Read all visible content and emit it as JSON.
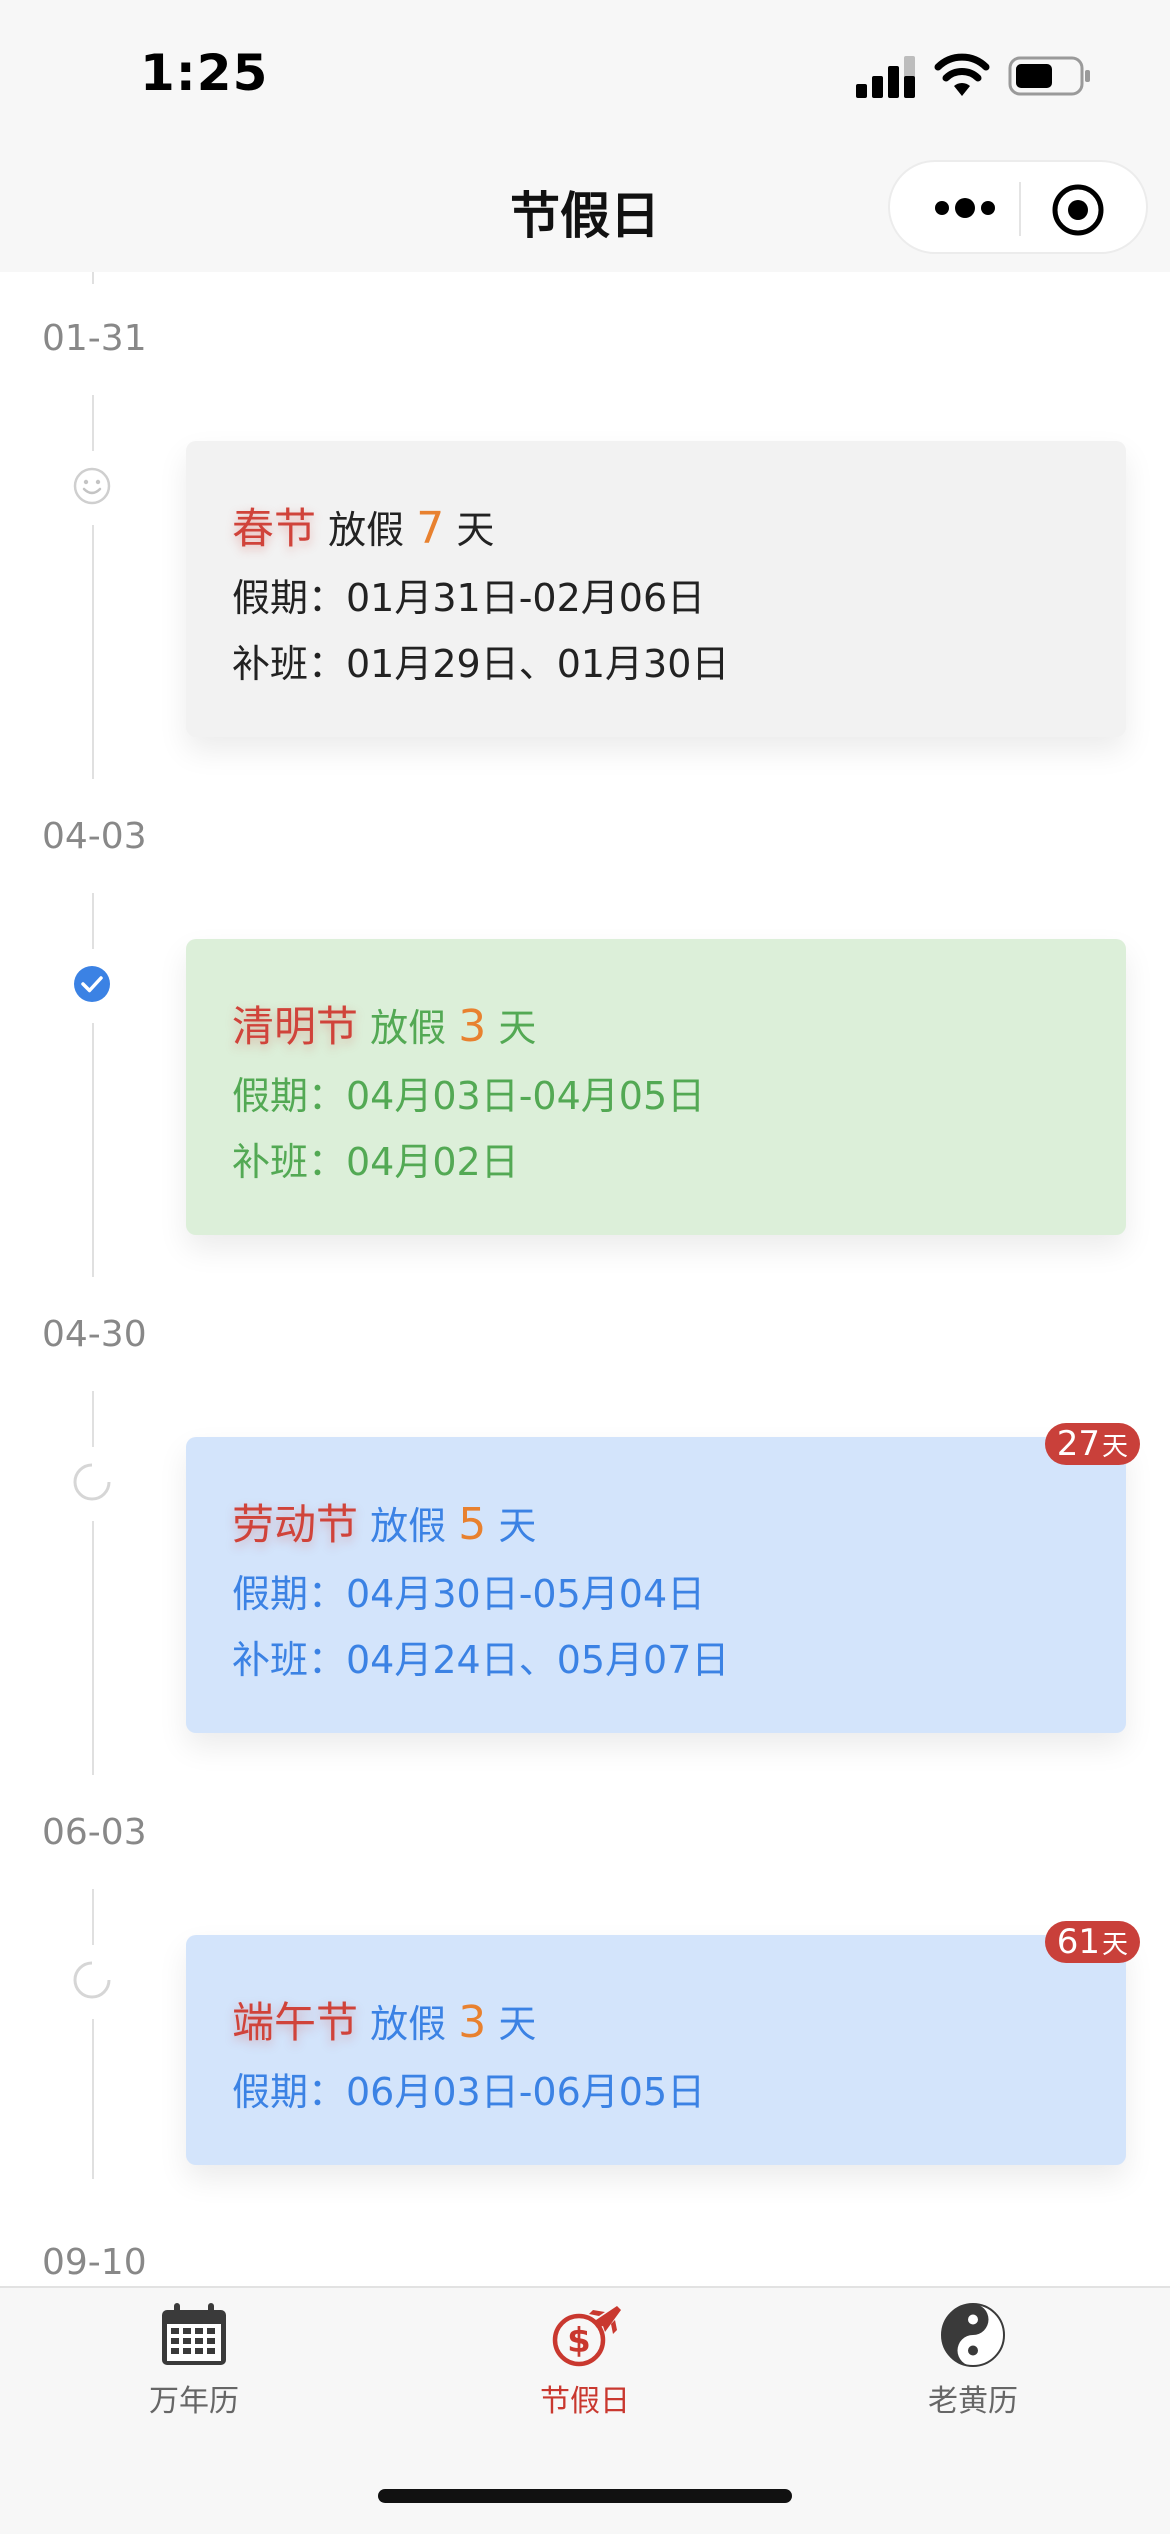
{
  "status_bar": {
    "time": "1:25"
  },
  "nav": {
    "title": "节假日"
  },
  "timeline": [
    {
      "date": "01-31",
      "name": "春节",
      "off_label": "放假",
      "days": "7",
      "unit": "天",
      "holiday_text": "假期：01月31日-02月06日",
      "makeup_text": "补班：01月29日、01月30日",
      "status": "past",
      "status_icon": "smile-icon",
      "bg": "#f2f2f2",
      "text_color": "#222222",
      "badge": null
    },
    {
      "date": "04-03",
      "name": "清明节",
      "off_label": "放假",
      "days": "3",
      "unit": "天",
      "holiday_text": "假期：04月03日-04月05日",
      "makeup_text": "补班：04月02日",
      "status": "current",
      "status_icon": "check-circle-icon",
      "bg": "#dcefd9",
      "text_color": "#53a954",
      "badge": null
    },
    {
      "date": "04-30",
      "name": "劳动节",
      "off_label": "放假",
      "days": "5",
      "unit": "天",
      "holiday_text": "假期：04月30日-05月04日",
      "makeup_text": "补班：04月24日、05月07日",
      "status": "upcoming",
      "status_icon": "loading-circle-icon",
      "bg": "#d3e4fb",
      "text_color": "#3b82e4",
      "badge": {
        "value": "27",
        "unit": "天"
      }
    },
    {
      "date": "06-03",
      "name": "端午节",
      "off_label": "放假",
      "days": "3",
      "unit": "天",
      "holiday_text": "假期：06月03日-06月05日",
      "makeup_text": "",
      "status": "upcoming",
      "status_icon": "loading-circle-icon",
      "bg": "#d3e4fb",
      "text_color": "#3b82e4",
      "badge": {
        "value": "61",
        "unit": "天"
      }
    },
    {
      "date": "09-10"
    }
  ],
  "tabbar": {
    "tabs": [
      {
        "label": "万年历",
        "icon": "calendar-icon",
        "active": false
      },
      {
        "label": "节假日",
        "icon": "holiday-money-icon",
        "active": true
      },
      {
        "label": "老黄历",
        "icon": "yin-yang-icon",
        "active": false
      }
    ],
    "active_color": "#c9382f",
    "inactive_color": "#666666"
  }
}
